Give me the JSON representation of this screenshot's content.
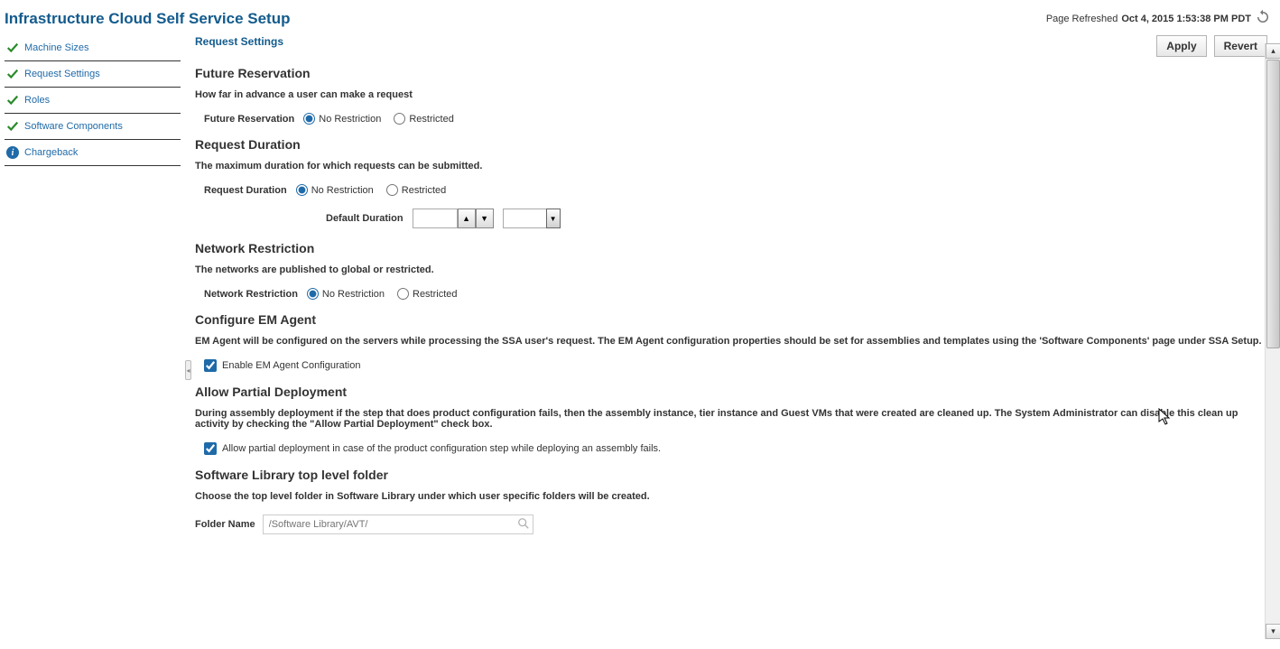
{
  "header": {
    "title": "Infrastructure Cloud Self Service Setup",
    "refresh_label": "Page Refreshed",
    "refresh_time": "Oct 4, 2015 1:53:38 PM PDT"
  },
  "sidebar": {
    "items": [
      {
        "label": "Machine Sizes",
        "icon": "check"
      },
      {
        "label": "Request Settings",
        "icon": "check"
      },
      {
        "label": "Roles",
        "icon": "check"
      },
      {
        "label": "Software Components",
        "icon": "check"
      },
      {
        "label": "Chargeback",
        "icon": "info"
      }
    ]
  },
  "toolbar": {
    "apply_label": "Apply",
    "revert_label": "Revert"
  },
  "content": {
    "request_settings_title": "Request Settings",
    "future_reservation": {
      "heading": "Future Reservation",
      "desc": "How far in advance a user can make a request",
      "label": "Future Reservation",
      "opt_no": "No Restriction",
      "opt_res": "Restricted",
      "selected": "no"
    },
    "request_duration": {
      "heading": "Request Duration",
      "desc": "The maximum duration for which requests can be submitted.",
      "label": "Request Duration",
      "opt_no": "No Restriction",
      "opt_res": "Restricted",
      "selected": "no",
      "default_label": "Default Duration",
      "default_value": "",
      "default_unit": ""
    },
    "network_restriction": {
      "heading": "Network Restriction",
      "desc": "The networks are published to global or restricted.",
      "label": "Network Restriction",
      "opt_no": "No Restriction",
      "opt_res": "Restricted",
      "selected": "no"
    },
    "em_agent": {
      "heading": "Configure EM Agent",
      "desc": "EM Agent will be configured on the servers while processing the SSA user's request. The EM Agent configuration properties should be set for assemblies and templates using the 'Software Components' page under SSA Setup.",
      "cb_label": "Enable EM Agent Configuration",
      "cb_checked": true
    },
    "partial_deploy": {
      "heading": "Allow Partial Deployment",
      "desc": "During assembly deployment if the step that does product configuration fails, then the assembly instance, tier instance and Guest VMs that were created are cleaned up. The System Administrator can disable this clean up activity by checking the \"Allow Partial Deployment\" check box.",
      "cb_label": "Allow partial deployment in case of the product configuration step while deploying an assembly fails.",
      "cb_checked": true
    },
    "sw_library": {
      "heading": "Software Library top level folder",
      "desc": "Choose the top level folder in Software Library under which user specific folders will be created.",
      "folder_label": "Folder Name",
      "folder_placeholder": "/Software Library/AVT/"
    }
  }
}
